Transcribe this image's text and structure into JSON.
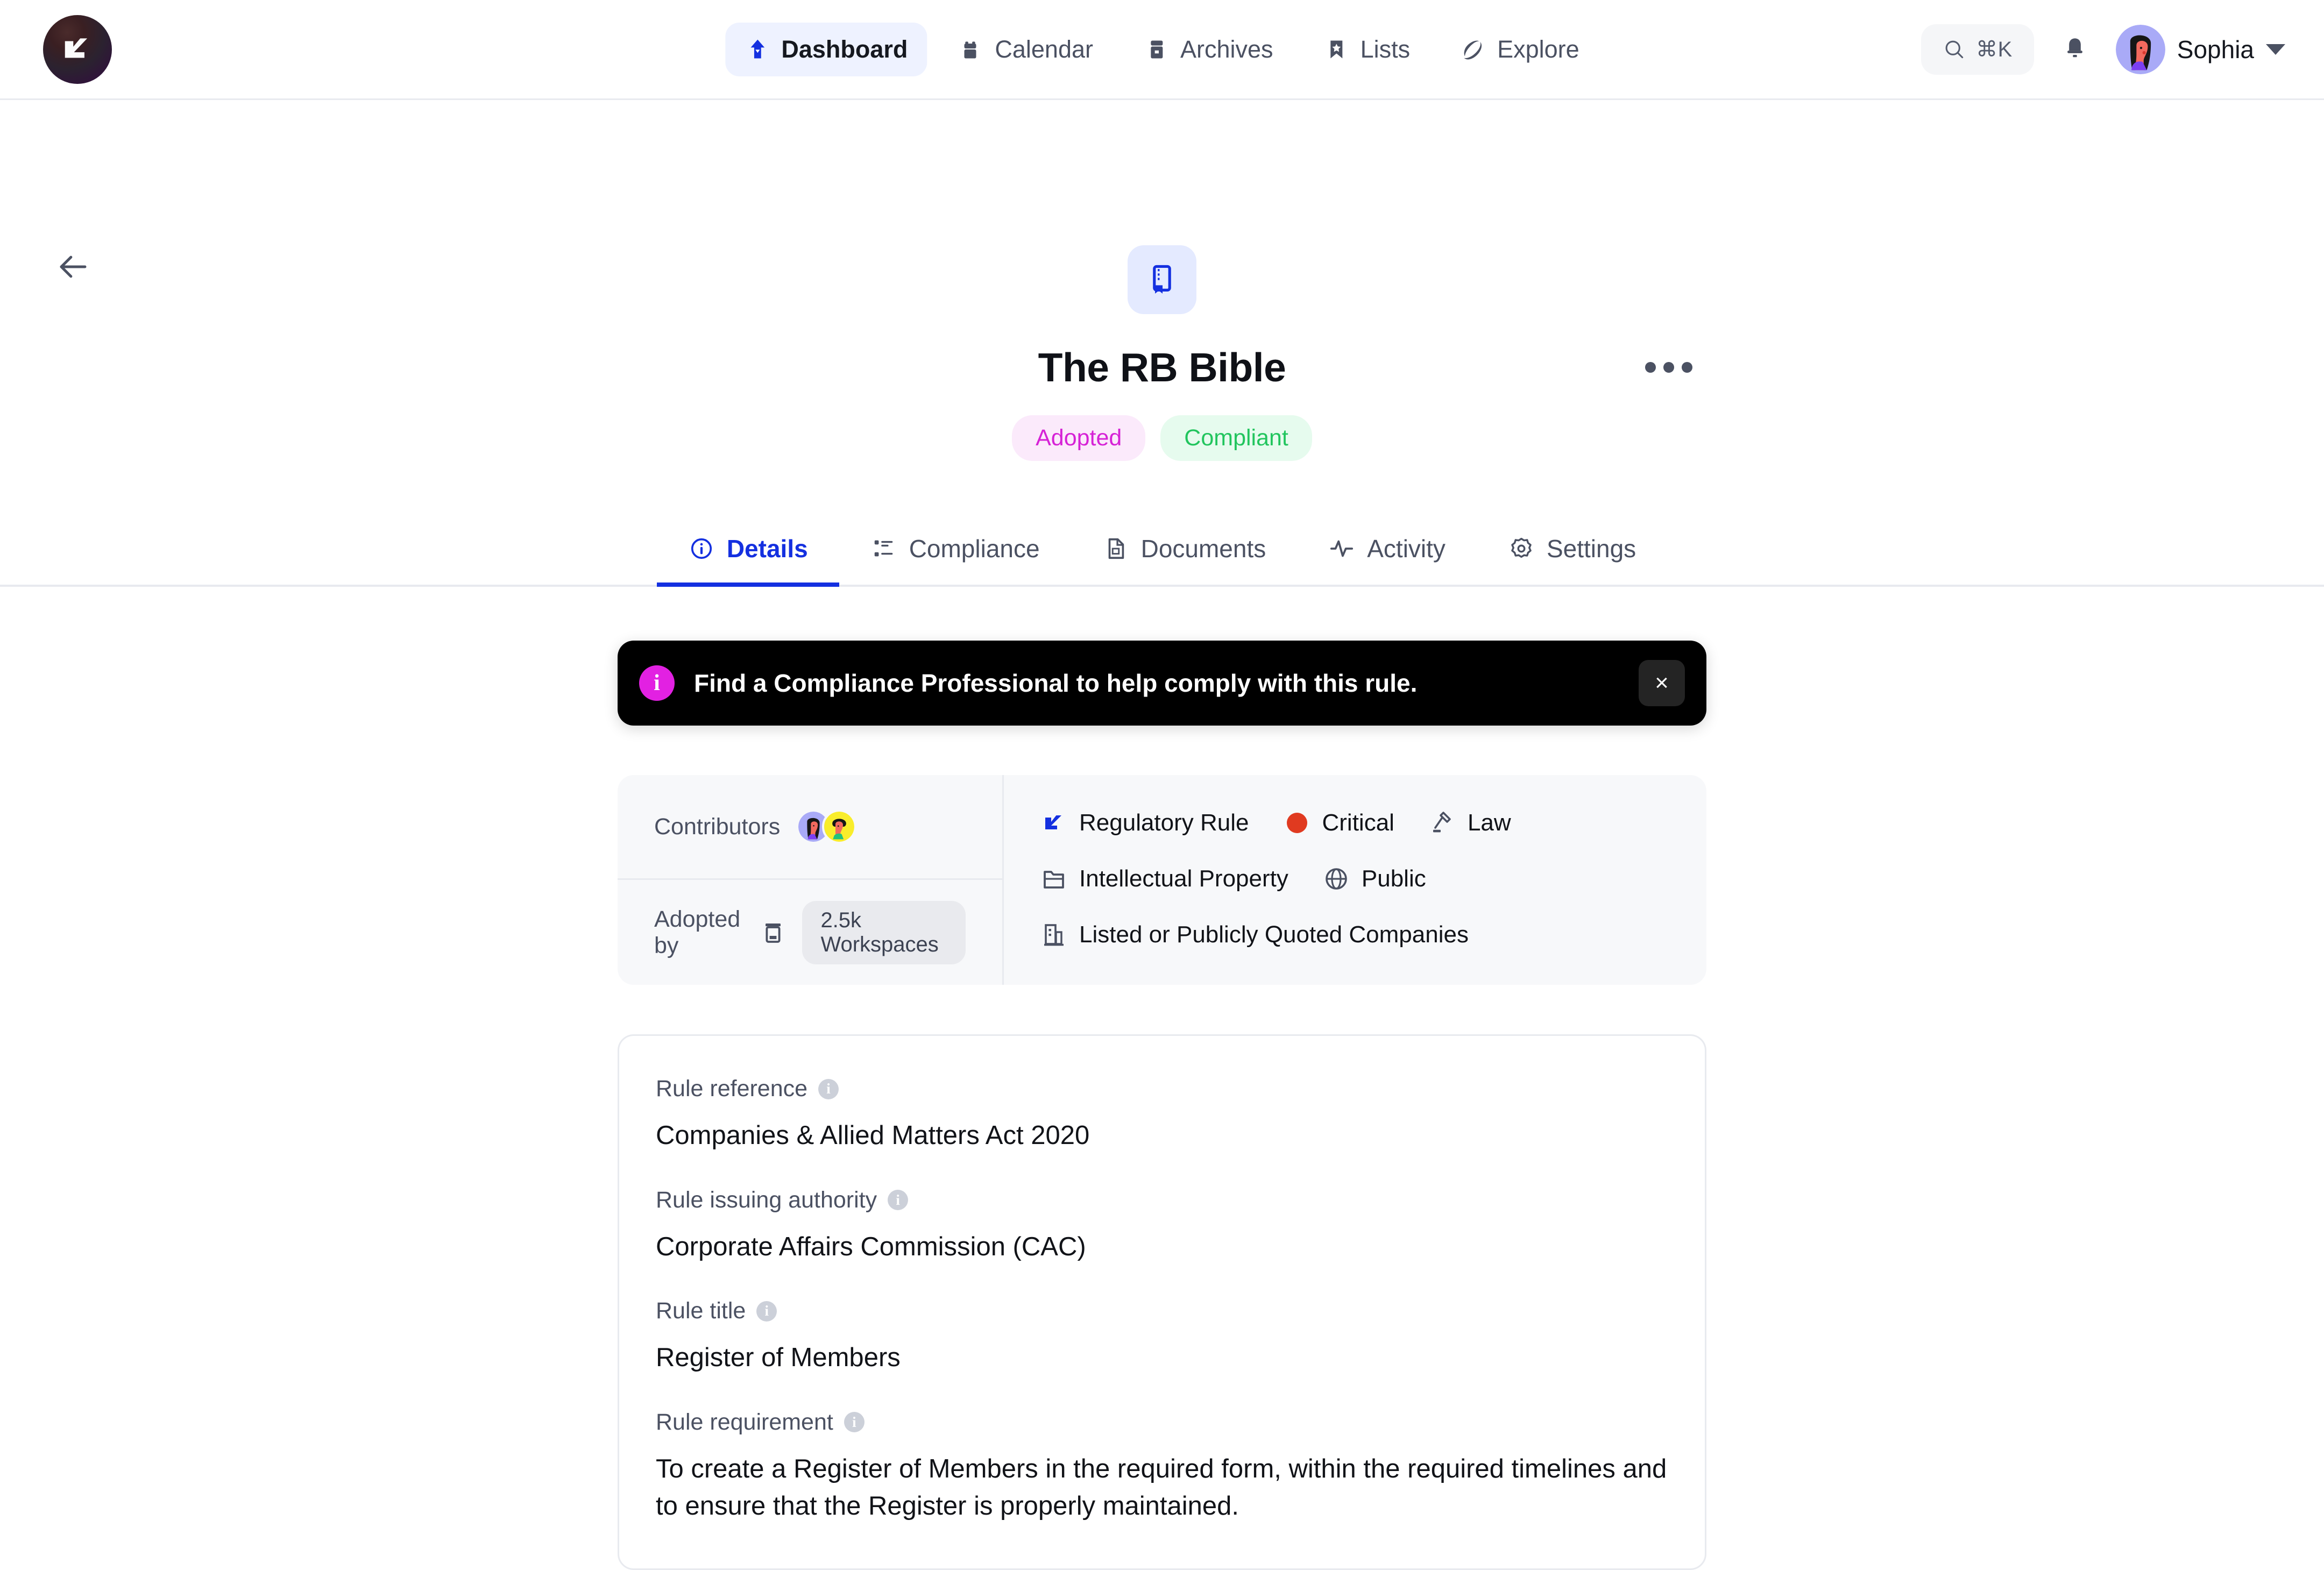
{
  "brand": {
    "logo_icon": "flag-check-logo"
  },
  "nav": {
    "items": [
      {
        "label": "Dashboard",
        "icon": "dashboard-arrow-icon",
        "active": true
      },
      {
        "label": "Calendar",
        "icon": "calendar-icon",
        "active": false
      },
      {
        "label": "Archives",
        "icon": "archive-box-icon",
        "active": false
      },
      {
        "label": "Lists",
        "icon": "bookmark-star-icon",
        "active": false
      },
      {
        "label": "Explore",
        "icon": "explore-planet-icon",
        "active": false
      }
    ]
  },
  "topbar_right": {
    "search_shortcut": "⌘K",
    "search_icon": "search-icon",
    "bell_icon": "bell-icon",
    "user_name": "Sophia",
    "avatar_icon": "user-avatar",
    "caret_icon": "chevron-down-icon"
  },
  "back_button": {
    "icon": "arrow-left-icon"
  },
  "header": {
    "doc_icon": "book-bookmark-icon",
    "title": "The RB Bible",
    "more_icon": "more-horizontal-icon",
    "badges": [
      {
        "label": "Adopted",
        "bg": "#fbeafb",
        "color": "#d622d6"
      },
      {
        "label": "Compliant",
        "bg": "#e6fbee",
        "color": "#22c55e"
      }
    ]
  },
  "tabs": [
    {
      "label": "Details",
      "icon": "info-circle-icon",
      "active": true
    },
    {
      "label": "Compliance",
      "icon": "checklist-icon",
      "active": false
    },
    {
      "label": "Documents",
      "icon": "document-icon",
      "active": false
    },
    {
      "label": "Activity",
      "icon": "activity-pulse-icon",
      "active": false
    },
    {
      "label": "Settings",
      "icon": "gear-icon",
      "active": false
    }
  ],
  "banner": {
    "icon": "info-exclamation-icon",
    "text": "Find a Compliance Professional to help comply with this rule.",
    "close_label": "×"
  },
  "meta": {
    "contributors_label": "Contributors",
    "adopted_by_label": "Adopted by",
    "adopted_by_icon": "store-icon",
    "adopted_by_value": "2.5k Workspaces",
    "rows": [
      [
        {
          "label": "Regulatory Rule",
          "icon": "regulatory-rule-icon"
        },
        {
          "label": "Critical",
          "icon": "critical-dot-icon"
        },
        {
          "label": "Law",
          "icon": "gavel-law-icon"
        }
      ],
      [
        {
          "label": "Intellectual Property",
          "icon": "folder-icon"
        },
        {
          "label": "Public",
          "icon": "globe-icon"
        }
      ],
      [
        {
          "label": "Listed or Publicly Quoted Companies",
          "icon": "building-icon"
        }
      ]
    ]
  },
  "details": {
    "fields": [
      {
        "label": "Rule reference",
        "value": "Companies & Allied Matters Act 2020"
      },
      {
        "label": "Rule issuing authority",
        "value": "Corporate Affairs Commission (CAC)"
      },
      {
        "label": "Rule title",
        "value": "Register of Members"
      },
      {
        "label": "Rule requirement",
        "value": "To create a Register of Members in the required form, within the required timelines and to ensure that the Register is properly maintained."
      }
    ],
    "info_glyph": "i"
  }
}
